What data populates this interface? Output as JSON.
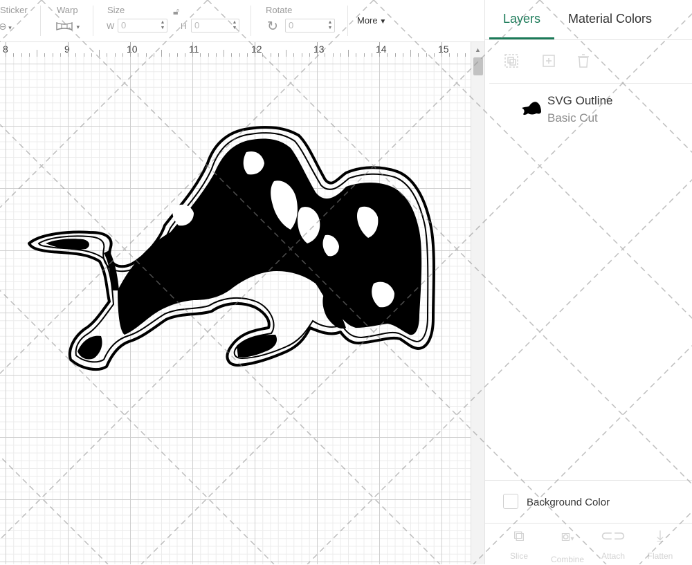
{
  "toolbar": {
    "sticker_label": "Sticker",
    "warp_label": "Warp",
    "size_label": "Size",
    "width_prefix": "W",
    "width_value": "0",
    "height_prefix": "H",
    "height_value": "0",
    "rotate_label": "Rotate",
    "rotate_value": "0",
    "more_label": "More"
  },
  "ruler": {
    "numbers": [
      "8",
      "9",
      "10",
      "11",
      "12",
      "13",
      "14",
      "15"
    ]
  },
  "panel": {
    "tabs": [
      {
        "label": "Layers",
        "active": true
      },
      {
        "label": "Material Colors",
        "active": false
      }
    ],
    "layer_tools": [
      "group-icon",
      "duplicate-icon",
      "delete-icon"
    ],
    "layer": {
      "name": "SVG Outline",
      "type": "Basic Cut"
    },
    "background_color_label": "Background Color",
    "bottom_actions": [
      {
        "label": "Slice",
        "icon": "slice-icon"
      },
      {
        "label": "Combine",
        "icon": "combine-icon"
      },
      {
        "label": "Attach",
        "icon": "attach-icon"
      },
      {
        "label": "Flatten",
        "icon": "flatten-icon"
      }
    ]
  },
  "colors": {
    "accent": "#1b7a58",
    "design": "#000000"
  }
}
